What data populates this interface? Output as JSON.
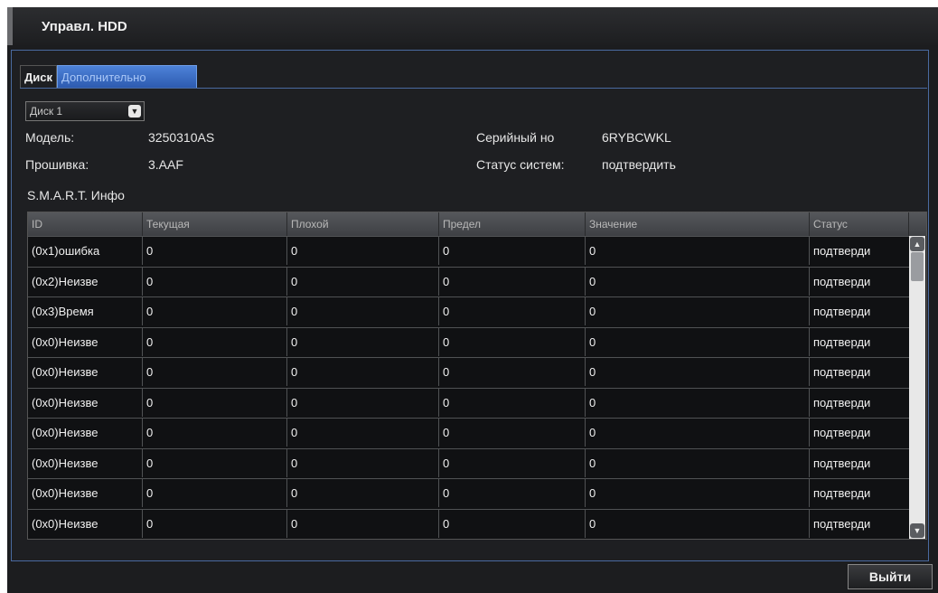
{
  "window": {
    "title": "Управл. HDD"
  },
  "tabs": [
    {
      "label": "Диск",
      "active": false
    },
    {
      "label": "Дополнительно",
      "active": true
    }
  ],
  "disk_select": {
    "value": "Диск 1"
  },
  "info": {
    "model_label": "Модель:",
    "model_value": "3250310AS",
    "firmware_label": "Прошивка:",
    "firmware_value": "3.AAF",
    "serial_label": "Серийный но",
    "serial_value": "6RYBCWKL",
    "status_label": "Статус систем:",
    "status_value": "подтвердить"
  },
  "smart": {
    "title": "S.M.A.R.T. Инфо",
    "columns": [
      "ID",
      "Текущая",
      "Плохой",
      "Предел",
      "Значение",
      "Статус"
    ],
    "rows": [
      [
        "(0x1)ошибка",
        "0",
        "0",
        "0",
        "0",
        "подтверди"
      ],
      [
        "(0x2)Неизве",
        "0",
        "0",
        "0",
        "0",
        "подтверди"
      ],
      [
        "(0x3)Время",
        "0",
        "0",
        "0",
        "0",
        "подтверди"
      ],
      [
        "(0x0)Неизве",
        "0",
        "0",
        "0",
        "0",
        "подтверди"
      ],
      [
        "(0x0)Неизве",
        "0",
        "0",
        "0",
        "0",
        "подтверди"
      ],
      [
        "(0x0)Неизве",
        "0",
        "0",
        "0",
        "0",
        "подтверди"
      ],
      [
        "(0x0)Неизве",
        "0",
        "0",
        "0",
        "0",
        "подтверди"
      ],
      [
        "(0x0)Неизве",
        "0",
        "0",
        "0",
        "0",
        "подтверди"
      ],
      [
        "(0x0)Неизве",
        "0",
        "0",
        "0",
        "0",
        "подтверди"
      ],
      [
        "(0x0)Неизве",
        "0",
        "0",
        "0",
        "0",
        "подтверди"
      ]
    ]
  },
  "footer": {
    "exit_label": "Выйти"
  },
  "colors": {
    "accent": "#2d5bb0",
    "panel_border": "#4a6aa0",
    "background": "#1c1d1f"
  }
}
